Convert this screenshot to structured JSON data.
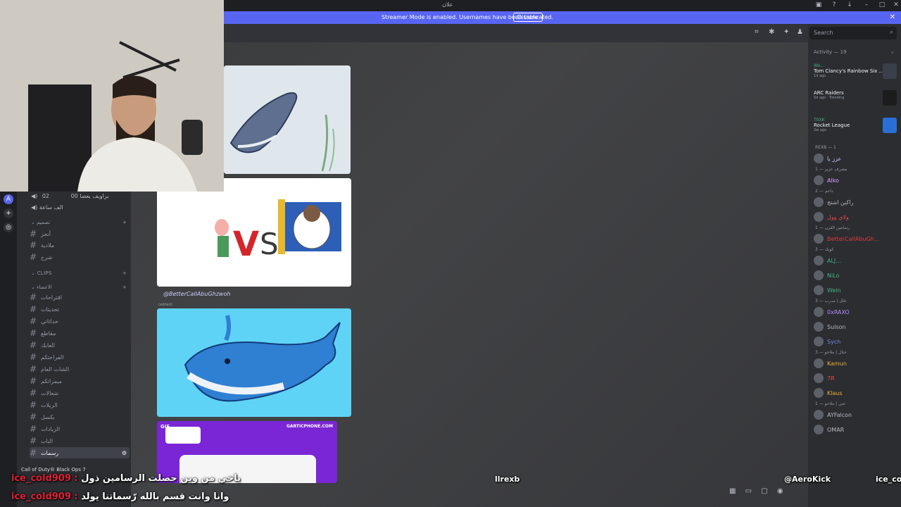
{
  "window": {
    "title": "علان"
  },
  "streamer_bar": {
    "message": "Streamer Mode is enabled. Usernames have been truncated.",
    "disable_label": "Disable"
  },
  "search": {
    "placeholder": "Search"
  },
  "sidebar": {
    "voice_channels": [
      {
        "label": "براويف بعضا",
        "count": "00",
        "count2": "02"
      },
      {
        "label": "الف ساعة"
      }
    ],
    "category_1": "تصميم",
    "category_2": "CLIPS",
    "category_3": "الاعضاء",
    "channels": [
      {
        "label": "أنجز"
      },
      {
        "label": "ملادية"
      },
      {
        "label": "شرح"
      },
      {
        "label": "اقتراحات"
      },
      {
        "label": "تحديثات"
      },
      {
        "label": "حداثاتي"
      },
      {
        "label": "مقاطع"
      },
      {
        "label": "العابك"
      },
      {
        "label": "الفراحتكم"
      },
      {
        "label": "الشات العام"
      },
      {
        "label": "ميمزاتكم"
      },
      {
        "label": "شعالات"
      },
      {
        "label": "الريلات"
      },
      {
        "label": "بكسل"
      },
      {
        "label": "الزيادات"
      },
      {
        "label": "الباب"
      },
      {
        "label": "رسمات"
      }
    ],
    "now_playing": "Call of Duty® Black Ops 7"
  },
  "content": {
    "mention": "@BetterCallAbuGhzwoh",
    "edited": "(edited)",
    "gif_badge": "GIF",
    "gartic_url": "GARTICPHONE.COM"
  },
  "activity": {
    "header": "Activity — 19",
    "items": [
      {
        "name": "Wo...",
        "game": "Tom Clancy's Rainbow Six ...",
        "sub": "1d ago",
        "color": "#3a3f4a"
      },
      {
        "name": "",
        "game": "ARC Raiders",
        "sub": "5d ago · Trending",
        "color": "#1c1c1c"
      },
      {
        "name": "T0XK",
        "game": "Rocket League",
        "sub": "2w ago",
        "color": "#2a6fd6"
      }
    ]
  },
  "members": [
    {
      "group": "REXB — 1",
      "name": "عزز يا",
      "color": "#c9cdfb"
    },
    {
      "group": "مشرف عزيز — 1",
      "name": "Alko",
      "color": "#e0a0ff"
    },
    {
      "group": "داعم — 2",
      "name": "راكين اشتج",
      "color": "#b5bac1"
    },
    {
      "group": "",
      "name": "ولاي وول",
      "color": "#f04747"
    },
    {
      "group": "رسامين القرن — 1",
      "name": "BetterCallAbuGh...",
      "color": "#d83c3e"
    },
    {
      "group": "كويك — 3",
      "name": "ALJ...",
      "color": "#43b581"
    },
    {
      "group": "",
      "name": "NiLo",
      "color": "#43b581"
    },
    {
      "group": "",
      "name": "Wein",
      "color": "#43b581"
    },
    {
      "group": "خلل | مدرب — 3",
      "name": "0xRAXO",
      "color": "#b48bff"
    },
    {
      "group": "",
      "name": "Sulson",
      "color": "#b5bac1"
    },
    {
      "group": "",
      "name": "Sych",
      "color": "#7289da"
    },
    {
      "group": "حتال | ملاحو — 3",
      "name": "Kamun",
      "color": "#f0b232"
    },
    {
      "group": "",
      "name": "7R",
      "color": "#f04747"
    },
    {
      "group": "",
      "name": "Klaus",
      "color": "#f0b232"
    },
    {
      "group": "عني | ملاحو — 1",
      "name": "AYFalcon",
      "color": "#b5bac1"
    },
    {
      "group": "",
      "name": "OMAR",
      "color": "#b5bac1"
    }
  ],
  "stream_chat": {
    "line1_nick": "ice_cold909 :",
    "line1_text": "ياخي من وين حصلت الرسامين ذول",
    "line2_nick": "ice_cold909 :",
    "line2_text": "وانا وانت قسم بالله رّسماتنا يولد",
    "center_name": "llrexb",
    "right_name1": "@AeroKick",
    "right_name2": "ice_col"
  }
}
